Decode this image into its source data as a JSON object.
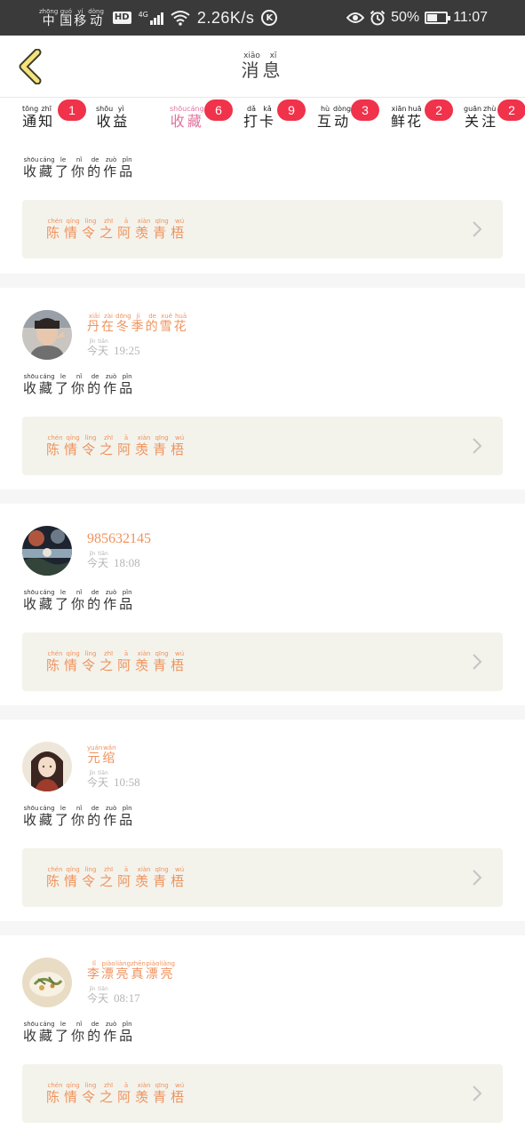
{
  "status_bar": {
    "carrier": [
      {
        "py": "zhōng",
        "ch": "中"
      },
      {
        "py": "guó",
        "ch": "国"
      },
      {
        "py": "yí",
        "ch": "移"
      },
      {
        "py": "dòng",
        "ch": "动"
      }
    ],
    "hd": "HD",
    "network": "4G",
    "speed": "2.26K/s",
    "k_icon": "K",
    "battery_text": "50%",
    "battery_level": 0.5,
    "time": "11:07",
    "icons": [
      "eye-icon",
      "alarm-icon",
      "wifi-icon",
      "signal-icon",
      "battery-icon"
    ]
  },
  "header": {
    "title": [
      {
        "py": "xiāo",
        "ch": "消"
      },
      {
        "py": "xī",
        "ch": "息"
      }
    ],
    "back_icon": "chevron-left-icon",
    "back_color": "#f5e27a"
  },
  "tabs": [
    {
      "key": "notify",
      "chars": [
        {
          "py": "tōng",
          "ch": "通"
        },
        {
          "py": "zhī",
          "ch": "知"
        }
      ],
      "badge": "1",
      "active": false
    },
    {
      "key": "earnings",
      "chars": [
        {
          "py": "shōu",
          "ch": "收"
        },
        {
          "py": "yì",
          "ch": "益"
        }
      ],
      "badge": "",
      "active": false
    },
    {
      "key": "favorites",
      "chars": [
        {
          "py": "shōu",
          "ch": "收"
        },
        {
          "py": "cáng",
          "ch": "藏"
        }
      ],
      "badge": "6",
      "active": true
    },
    {
      "key": "checkin",
      "chars": [
        {
          "py": "dǎ",
          "ch": "打"
        },
        {
          "py": "kǎ",
          "ch": "卡"
        }
      ],
      "badge": "9",
      "active": false
    },
    {
      "key": "interact",
      "chars": [
        {
          "py": "hù",
          "ch": "互"
        },
        {
          "py": "dòng",
          "ch": "动"
        }
      ],
      "badge": "3",
      "active": false
    },
    {
      "key": "flowers",
      "chars": [
        {
          "py": "xiān",
          "ch": "鲜"
        },
        {
          "py": "huā",
          "ch": "花"
        }
      ],
      "badge": "2",
      "active": false
    },
    {
      "key": "follow",
      "chars": [
        {
          "py": "guān",
          "ch": "关"
        },
        {
          "py": "zhù",
          "ch": "注"
        }
      ],
      "badge": "2",
      "active": false
    }
  ],
  "colors": {
    "accent_pink": "#e0739f",
    "badge_red": "#f0324b",
    "orange_text": "#f0925c",
    "box_bg": "#f3f3ec"
  },
  "message_text": [
    {
      "py": "shōu",
      "ch": "收"
    },
    {
      "py": "cáng",
      "ch": "藏"
    },
    {
      "py": "le",
      "ch": "了"
    },
    {
      "py": "nǐ",
      "ch": "你"
    },
    {
      "py": "de",
      "ch": "的"
    },
    {
      "py": "zuò",
      "ch": "作"
    },
    {
      "py": "pǐn",
      "ch": "品"
    }
  ],
  "work_title": [
    {
      "py": "chén",
      "ch": "陈"
    },
    {
      "py": "qíng",
      "ch": "情"
    },
    {
      "py": "lìng",
      "ch": "令"
    },
    {
      "py": "zhī",
      "ch": "之"
    },
    {
      "py": "ā",
      "ch": "阿"
    },
    {
      "py": "xiàn",
      "ch": "羡"
    },
    {
      "py": "qīng",
      "ch": "青"
    },
    {
      "py": "wú",
      "ch": "梧"
    }
  ],
  "today": [
    {
      "py": "jīn",
      "ch": "今"
    },
    {
      "py": "tiān",
      "ch": "天"
    }
  ],
  "notifications": [
    {
      "user": null,
      "time": ""
    },
    {
      "user": {
        "name_chars": [
          {
            "py": "xiǎi",
            "ch": "丹"
          },
          {
            "py": "zài",
            "ch": "在"
          },
          {
            "py": "dōng",
            "ch": "冬"
          },
          {
            "py": "jì",
            "ch": "季"
          },
          {
            "py": "de",
            "ch": "的"
          },
          {
            "py": "xuě",
            "ch": "雪"
          },
          {
            "py": "huā",
            "ch": "花"
          }
        ],
        "name_text": "",
        "avatar": "avatar-boy-photo"
      },
      "time": "19:25"
    },
    {
      "user": {
        "name_chars": [],
        "name_text": "985632145",
        "avatar": "avatar-landscape-photo"
      },
      "time": "18:08"
    },
    {
      "user": {
        "name_chars": [
          {
            "py": "yuán",
            "ch": "元"
          },
          {
            "py": "wǎn",
            "ch": "绾"
          }
        ],
        "name_text": "",
        "avatar": "avatar-anime-girl"
      },
      "time": "10:58"
    },
    {
      "user": {
        "name_chars": [
          {
            "py": "lǐ",
            "ch": "李"
          },
          {
            "py": "piào",
            "ch": "漂"
          },
          {
            "py": "liàng",
            "ch": "亮"
          },
          {
            "py": "zhēn",
            "ch": "真"
          },
          {
            "py": "piào",
            "ch": "漂"
          },
          {
            "py": "liàng",
            "ch": "亮"
          }
        ],
        "name_text": "",
        "avatar": "avatar-food-photo"
      },
      "time": "08:17"
    }
  ]
}
